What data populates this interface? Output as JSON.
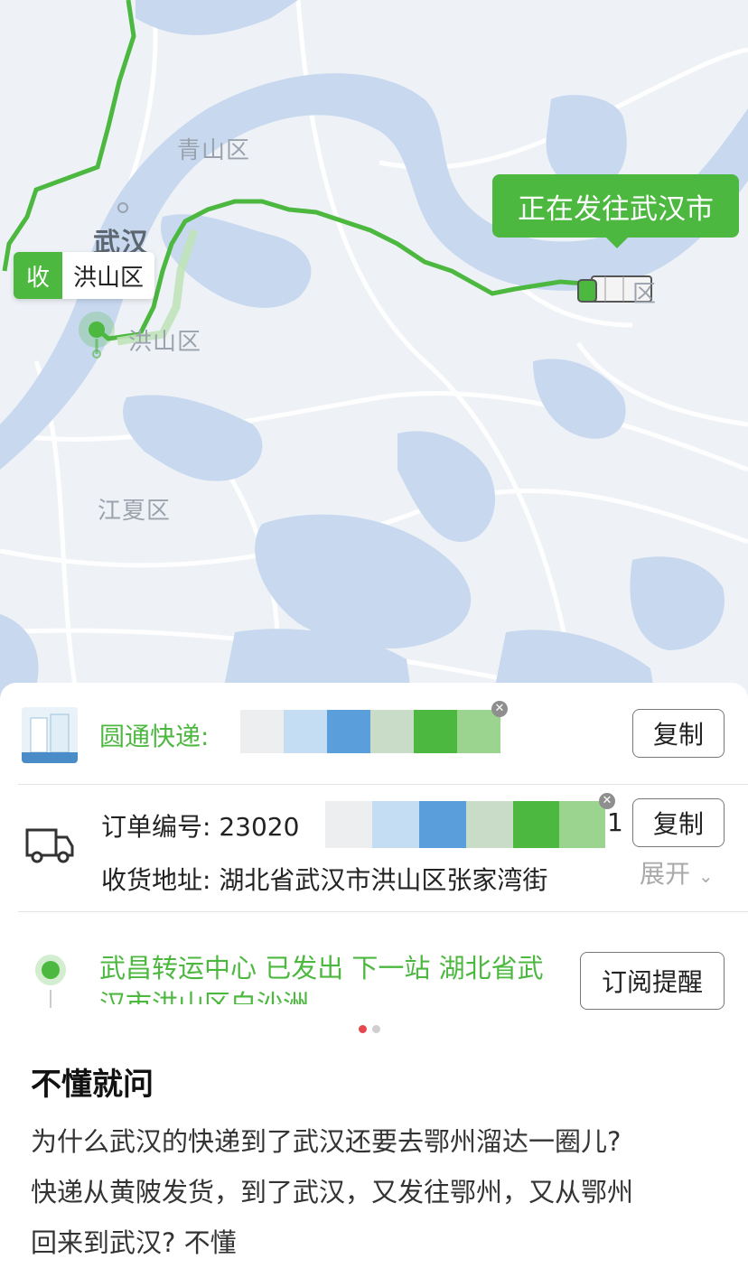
{
  "map": {
    "labels": {
      "qingshan": "青山区",
      "wuhan": "武汉",
      "hongshan": "洪山区",
      "jiangxia": "江夏区",
      "district_partial": "区"
    },
    "callout": "正在发往武汉市",
    "receiver_tag": "收",
    "receiver_district": "洪山区",
    "colors": {
      "route": "#4cb83f",
      "water": "#c7d8ef",
      "land": "#eef2f7",
      "road": "#ffffff"
    }
  },
  "panel": {
    "carrier_label": "圆通快递:",
    "copy_button_1": "复制",
    "order_number_label": "订单编号: 23020",
    "order_number_tail": "1",
    "copy_button_2": "复制",
    "address_label": "收货地址: 湖北省武汉市洪山区张家湾街",
    "expand_label": "展开",
    "tracking_text": "武昌转运中心 已发出 下一站 湖北省武汉市洪山区白沙洲",
    "subscribe_button": "订阅提醒",
    "mosaic_colors": [
      "#eceeef",
      "#c4ddf3",
      "#5a9edb",
      "#c9dcc8",
      "#4cb83f",
      "#9bd48e"
    ]
  },
  "pager": {
    "active_index": 0,
    "count": 2
  },
  "qa": {
    "title": "不懂就问",
    "line1": "为什么武汉的快递到了武汉还要去鄂州溜达一圈儿?",
    "line2": "快递从黄陂发货，到了武汉，又发往鄂州，又从鄂州",
    "line3": "回来到武汉? 不懂"
  }
}
